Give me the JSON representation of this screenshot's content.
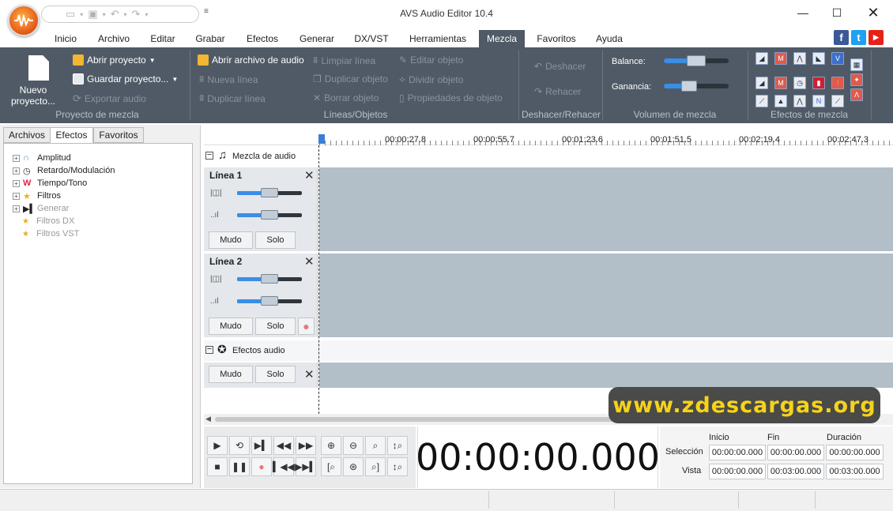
{
  "window": {
    "title": "AVS Audio Editor 10.4"
  },
  "menu": {
    "tabs": [
      "Inicio",
      "Archivo",
      "Editar",
      "Grabar",
      "Efectos",
      "Generar",
      "DX/VST",
      "Herramientas",
      "Mezcla",
      "Favoritos",
      "Ayuda"
    ],
    "active": "Mezcla"
  },
  "ribbon": {
    "project": {
      "new_label": "Nuevo proyecto...",
      "open_label": "Abrir proyecto",
      "save_label": "Guardar proyecto...",
      "export_label": "Exportar audio",
      "group_label": "Proyecto de mezcla"
    },
    "lines": {
      "open_audio": "Abrir archivo de audio",
      "new_line": "Nueva línea",
      "duplicate_line": "Duplicar línea",
      "clear_line": "Limpiar línea",
      "duplicate_object": "Duplicar objeto",
      "delete_object": "Borrar objeto",
      "edit_object": "Editar objeto",
      "split_object": "Dividir objeto",
      "object_props": "Propiedades de objeto",
      "group_label": "Líneas/Objetos"
    },
    "undo": {
      "undo_label": "Deshacer",
      "redo_label": "Rehacer",
      "group_label": "Deshacer/Rehacer"
    },
    "volume": {
      "balance_label": "Balance:",
      "gain_label": "Ganancia:",
      "group_label": "Volumen de mezcla"
    },
    "effects": {
      "group_label": "Efectos de mezcla"
    }
  },
  "left_panel": {
    "tabs": [
      "Archivos",
      "Efectos",
      "Favoritos"
    ],
    "active_tab": "Efectos",
    "tree": [
      {
        "label": "Amplitud",
        "enabled": true
      },
      {
        "label": "Retardo/Modulación",
        "enabled": true
      },
      {
        "label": "Tiempo/Tono",
        "enabled": true
      },
      {
        "label": "Filtros",
        "enabled": true
      },
      {
        "label": "Generar",
        "enabled": false
      },
      {
        "label": "Filtros DX",
        "enabled": false
      },
      {
        "label": "Filtros VST",
        "enabled": false
      }
    ]
  },
  "timeline": {
    "ruler_ticks": [
      "00:00:27.8",
      "00:00:55.7",
      "00:01:23.6",
      "00:01:51.5",
      "00:02:19.4",
      "00:02:47.3"
    ],
    "mix_header": "Mezcla de audio",
    "tracks": [
      {
        "name": "Línea 1",
        "mute": "Mudo",
        "solo": "Solo"
      },
      {
        "name": "Línea 2",
        "mute": "Mudo",
        "solo": "Solo"
      }
    ],
    "effects_header": "Efectos audio",
    "effects_mute": "Mudo",
    "effects_solo": "Solo"
  },
  "timecode": "00:00:00.000",
  "selection_panel": {
    "col_start": "Inicio",
    "col_end": "Fin",
    "col_duration": "Duración",
    "row_selection": "Selección",
    "row_view": "Vista",
    "selection": {
      "start": "00:00:00.000",
      "end": "00:00:00.000",
      "duration": "00:00:00.000"
    },
    "view": {
      "start": "00:00:00.000",
      "end": "00:03:00.000",
      "duration": "00:03:00.000"
    }
  },
  "watermark": "www.zdescargas.org"
}
